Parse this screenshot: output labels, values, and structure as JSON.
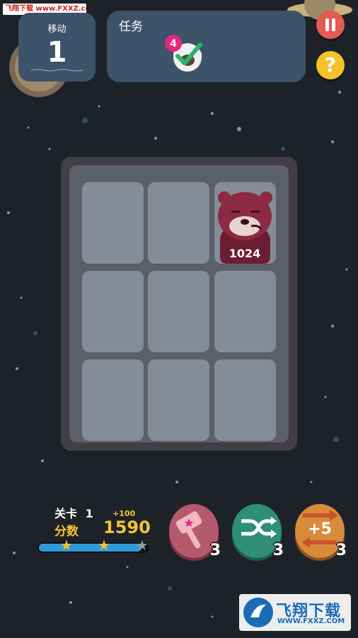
{
  "watermark_top": "飞翔下载 www.FXXZ.com",
  "moves": {
    "label": "移动",
    "value": "1"
  },
  "task": {
    "label": "任务",
    "count": "4",
    "icon": "sheep-check-icon"
  },
  "buttons": {
    "pause": "pause-icon",
    "help": "?"
  },
  "board": {
    "rows": 3,
    "cols": 3,
    "tile": {
      "value": "1024",
      "row": 0,
      "col": 2,
      "character": "bear-icon",
      "color": "#8c2a45"
    }
  },
  "stats": {
    "level_label": "关卡",
    "level_value": "1",
    "score_label": "分数",
    "score_bonus": "+100",
    "score_value": "1590"
  },
  "progress": {
    "fraction": 0.95,
    "stars_earned": 2,
    "stars_total": 3
  },
  "boosters": [
    {
      "name": "hammer",
      "icon": "hammer-icon",
      "count": "3",
      "color": "#b55a6d"
    },
    {
      "name": "shuffle",
      "icon": "shuffle-icon",
      "count": "3",
      "color": "#2f8f73"
    },
    {
      "name": "plus-five",
      "icon": "swap-arrows-icon",
      "label": "+5",
      "count": "3",
      "color": "#d98b3c"
    }
  ],
  "watermark_bottom": {
    "brand": "飞翔下载",
    "url": "WWW.FXXZ.COM"
  }
}
